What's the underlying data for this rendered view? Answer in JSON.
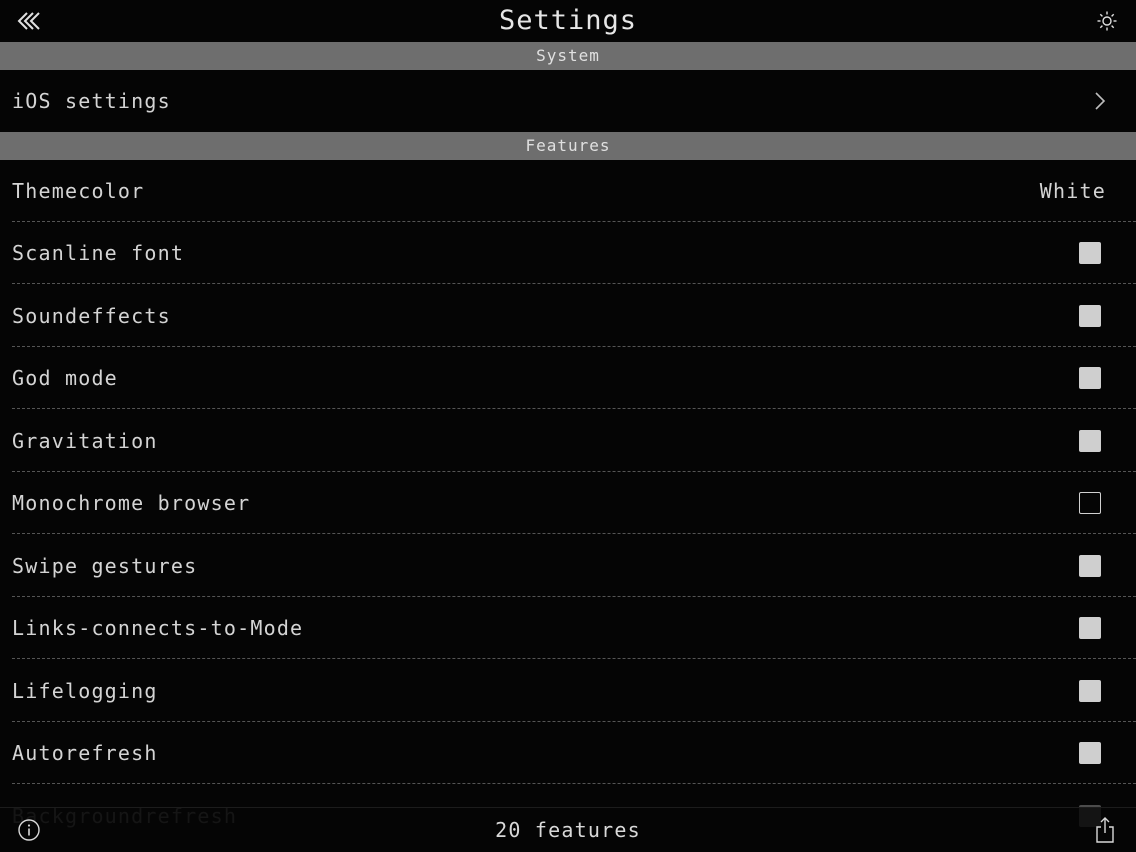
{
  "nav": {
    "title": "Settings",
    "back_icon": "double-chevron-left-icon",
    "brightness_icon": "sun-icon"
  },
  "sections": {
    "system": {
      "title": "System",
      "items": [
        {
          "label": "iOS settings",
          "accessory": "chevron-right-icon"
        }
      ]
    },
    "features": {
      "title": "Features",
      "themecolor": {
        "label": "Themecolor",
        "value": "White"
      },
      "items": [
        {
          "label": "Scanline font",
          "checked": true
        },
        {
          "label": "Soundeffects",
          "checked": true
        },
        {
          "label": "God mode",
          "checked": true
        },
        {
          "label": "Gravitation",
          "checked": true
        },
        {
          "label": "Monochrome browser",
          "checked": false
        },
        {
          "label": "Swipe gestures",
          "checked": true
        },
        {
          "label": "Links-connects-to-Mode",
          "checked": true
        },
        {
          "label": "Lifelogging",
          "checked": true
        },
        {
          "label": "Autorefresh",
          "checked": true
        },
        {
          "label": "Backgroundrefresh",
          "checked": true
        }
      ]
    }
  },
  "footer": {
    "count_label": "20 features",
    "info_icon": "info-icon",
    "share_icon": "share-icon"
  },
  "colors": {
    "background": "#050505",
    "section_header": "#6e6e6e",
    "text": "#d9d9d9",
    "checkbox_on": "#cfcfcf"
  }
}
